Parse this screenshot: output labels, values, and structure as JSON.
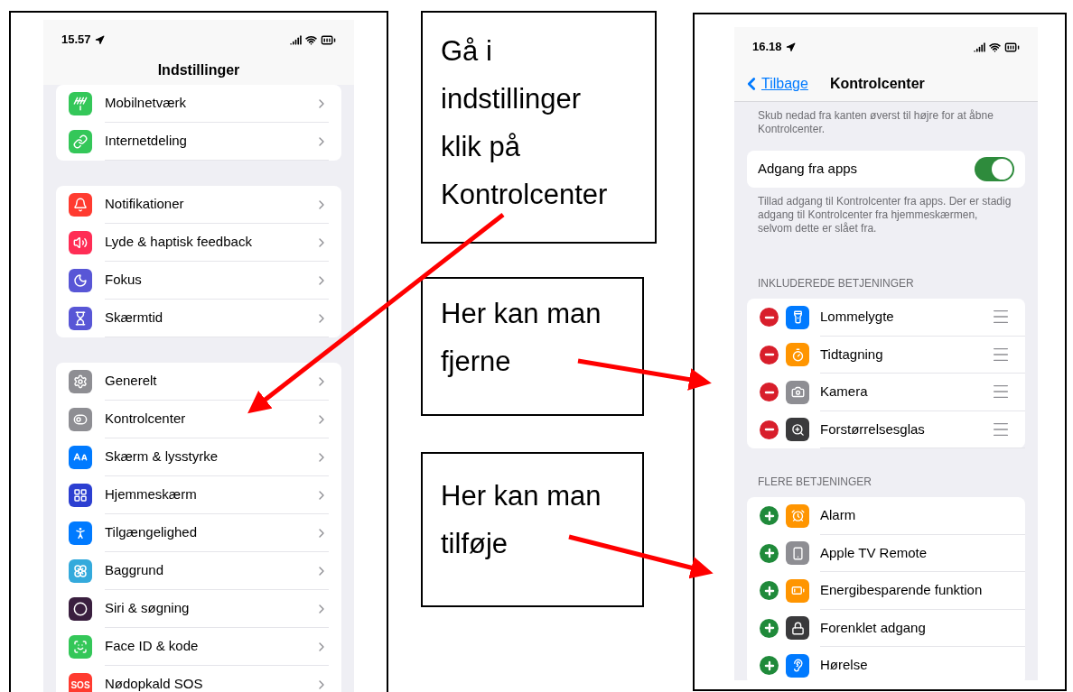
{
  "settings_phone": {
    "status_bar": {
      "time": "15.57"
    },
    "title": "Indstillinger",
    "groups": [
      {
        "items": [
          {
            "label": "Mobilnetværk",
            "color": "#34c759"
          },
          {
            "label": "Internetdeling",
            "color": "#34c759"
          }
        ]
      },
      {
        "items": [
          {
            "label": "Notifikationer",
            "color": "#ff3b30"
          },
          {
            "label": "Lyde & haptisk feedback",
            "color": "#ff2d55"
          },
          {
            "label": "Fokus",
            "color": "#5856d6"
          },
          {
            "label": "Skærmtid",
            "color": "#5856d6"
          }
        ]
      },
      {
        "items": [
          {
            "label": "Generelt",
            "color": "#8e8e93"
          },
          {
            "label": "Kontrolcenter",
            "color": "#8e8e93"
          },
          {
            "label": "Skærm & lysstyrke",
            "color": "#007aff"
          },
          {
            "label": "Hjemmeskærm",
            "color": "#2c3fd1"
          },
          {
            "label": "Tilgængelighed",
            "color": "#007aff"
          },
          {
            "label": "Baggrund",
            "color": "#34aadc"
          },
          {
            "label": "Siri & søgning",
            "color": "#3a1f3f"
          },
          {
            "label": "Face ID & kode",
            "color": "#34c759"
          },
          {
            "label": "Nødopkald SOS",
            "color": "#ff3b30",
            "icon_text": "SOS"
          }
        ]
      }
    ]
  },
  "notes": [
    {
      "text": "Gå i indstillinger klik på Kontrolcenter"
    },
    {
      "text": "Her kan man fjerne"
    },
    {
      "text": "Her kan man tilføje"
    }
  ],
  "control_phone": {
    "status_bar": {
      "time": "16.18"
    },
    "back": "Tilbage",
    "title": "Kontrolcenter",
    "intro": "Skub nedad fra kanten øverst til højre for at åbne Kontrolcenter.",
    "toggle": {
      "label": "Adgang fra apps",
      "on": true
    },
    "toggle_note": "Tillad adgang til Kontrolcenter fra apps. Der er stadig adgang til Kontrolcenter fra hjemmeskærmen, selvom dette er slået fra.",
    "sections": [
      {
        "kind": "included",
        "heading": "INKLUDEREDE BETJENINGER",
        "items": [
          {
            "label": "Lommelygte",
            "color": "#007aff"
          },
          {
            "label": "Tidtagning",
            "color": "#ff9500"
          },
          {
            "label": "Kamera",
            "color": "#8e8e93"
          },
          {
            "label": "Forstørrelsesglas",
            "color": "#3a3a3c"
          }
        ]
      },
      {
        "kind": "more",
        "heading": "FLERE BETJENINGER",
        "items": [
          {
            "label": "Alarm",
            "color": "#ff9500"
          },
          {
            "label": "Apple TV Remote",
            "color": "#8e8e93"
          },
          {
            "label": "Energibesparende funktion",
            "color": "#ff9500"
          },
          {
            "label": "Forenklet adgang",
            "color": "#3a3a3c"
          },
          {
            "label": "Hørelse",
            "color": "#007aff"
          }
        ]
      }
    ]
  }
}
